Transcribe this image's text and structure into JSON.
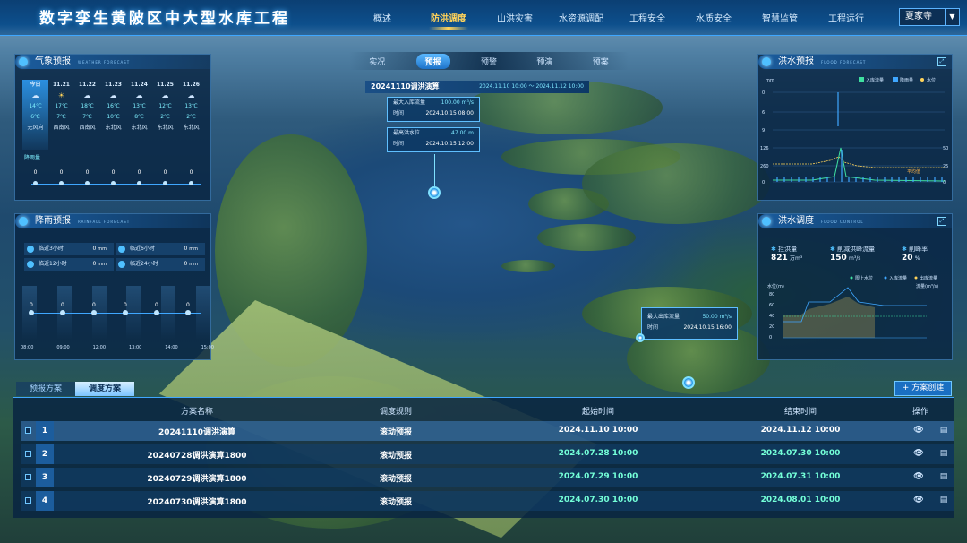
{
  "app_title": "数字孪生黄陂区中大型水库工程",
  "nav": [
    "概述",
    "防洪调度",
    "山洪灾害",
    "水资源调配",
    "工程安全",
    "水质安全",
    "智慧监管",
    "工程运行"
  ],
  "nav_active": 1,
  "site_select": "夏家寺",
  "subtabs": [
    "实况",
    "预报",
    "预警",
    "预演",
    "预案"
  ],
  "subtab_active": 1,
  "weather": {
    "title": "气象预报",
    "subtitle": "WEATHER FORECAST",
    "days": [
      {
        "date": "今日",
        "icon": "cloud-icon",
        "hi": "14℃",
        "lo": "6℃",
        "wind": "无风向"
      },
      {
        "date": "11.21",
        "icon": "sun-icon",
        "hi": "17℃",
        "lo": "7℃",
        "wind": "西南风"
      },
      {
        "date": "11.22",
        "icon": "cloud-icon",
        "hi": "18℃",
        "lo": "7℃",
        "wind": "西南风"
      },
      {
        "date": "11.23",
        "icon": "cloud-icon",
        "hi": "16℃",
        "lo": "10℃",
        "wind": "东北风"
      },
      {
        "date": "11.24",
        "icon": "cloud-icon",
        "hi": "13℃",
        "lo": "8℃",
        "wind": "东北风"
      },
      {
        "date": "11.25",
        "icon": "cloud-icon",
        "hi": "12℃",
        "lo": "2℃",
        "wind": "东北风"
      },
      {
        "date": "11.26",
        "icon": "cloud-icon",
        "hi": "13℃",
        "lo": "2℃",
        "wind": "东北风"
      }
    ],
    "rain_label": "降雨量",
    "rain_values": [
      "0",
      "0",
      "0",
      "0",
      "0",
      "0",
      "0"
    ]
  },
  "rainfall": {
    "title": "降雨预报",
    "subtitle": "RAINFALL FORECAST",
    "cells": [
      {
        "label": "临近3小时",
        "value": "0",
        "unit": "mm"
      },
      {
        "label": "临近6小时",
        "value": "0",
        "unit": "mm"
      },
      {
        "label": "临近12小时",
        "value": "0",
        "unit": "mm"
      },
      {
        "label": "临近24小时",
        "value": "0",
        "unit": "mm"
      }
    ],
    "values": [
      "0",
      "0",
      "0",
      "0",
      "0",
      "0"
    ],
    "xticks": [
      "08:00",
      "09:00",
      "12:00",
      "13:00",
      "14:00",
      "15:00"
    ]
  },
  "plan_popup": {
    "title": "20241110调洪演算",
    "range": "2024.11.10 10:00 ～ 2024.11.12 10:00",
    "max_in_label": "最大入库流量",
    "max_in_value": "100.00",
    "max_in_unit": "m³/s",
    "time_label": "时间",
    "max_in_time": "2024.10.15 08:00",
    "max_level_label": "最高洪水位",
    "max_level_value": "47.00",
    "max_level_unit": "m",
    "max_level_time": "2024.10.15 12:00"
  },
  "out_popup": {
    "max_out_label": "最大出库流量",
    "max_out_value": "50.00",
    "max_out_unit": "m³/s",
    "time_label": "时间",
    "time_value": "2024.10.15 16:00"
  },
  "flood_forecast": {
    "title": "洪水预报",
    "subtitle": "FLOOD FORECAST",
    "legend": [
      "入库流量",
      "降雨量",
      "水位"
    ],
    "y_left_label": "mm",
    "y_top_ticks": [
      "0",
      "6",
      "9"
    ],
    "y_bottom_ticks": [
      "126",
      "1146",
      "260",
      "0"
    ],
    "y_right_ticks": [
      "50",
      "25",
      "0"
    ],
    "flood_limit_label": "平均值",
    "colors": {
      "inflow": "#3fe0a0",
      "rain": "#3fa7ff",
      "level": "#ffd35a"
    }
  },
  "flood_control": {
    "title": "洪水调度",
    "subtitle": "FLOOD CONTROL",
    "stats": [
      {
        "label": "拦洪量",
        "value": "821",
        "unit": "万m³"
      },
      {
        "label": "削减洪峰流量",
        "value": "150",
        "unit": "m³/s"
      },
      {
        "label": "削峰率",
        "value": "20",
        "unit": "%"
      }
    ],
    "legend": [
      "限上水位",
      "入库流量",
      "出库流量"
    ],
    "y_left_label": "水位(m)",
    "y_right_label": "流量(m³/s)",
    "y_ticks": [
      "80",
      "60",
      "40",
      "20",
      "0"
    ]
  },
  "tabs": [
    "预报方案",
    "调度方案"
  ],
  "tab_active": 1,
  "create_button": "方案创建",
  "table": {
    "headers": [
      "方案名称",
      "调度规则",
      "起始时间",
      "结束时间",
      "操作"
    ],
    "rows": [
      {
        "no": "1",
        "name": "20241110调洪演算",
        "rule": "滚动预报",
        "start": "2024.11.10 10:00",
        "end": "2024.11.12 10:00"
      },
      {
        "no": "2",
        "name": "20240728调洪演算1800",
        "rule": "滚动预报",
        "start": "2024.07.28 10:00",
        "end": "2024.07.30 10:00"
      },
      {
        "no": "3",
        "name": "20240729调洪演算1800",
        "rule": "滚动预报",
        "start": "2024.07.29 10:00",
        "end": "2024.07.31 10:00"
      },
      {
        "no": "4",
        "name": "20240730调洪演算1800",
        "rule": "滚动预报",
        "start": "2024.07.30 10:00",
        "end": "2024.08.01 10:00"
      }
    ]
  }
}
